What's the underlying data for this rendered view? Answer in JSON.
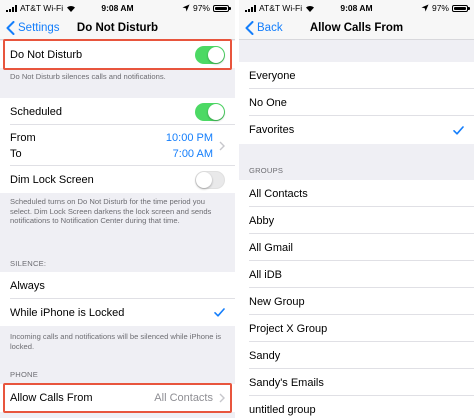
{
  "status_left": {
    "carrier": "AT&T Wi-Fi",
    "time": "9:08 AM",
    "battery": "97%"
  },
  "status_right": {
    "carrier": "AT&T Wi-Fi",
    "time": "9:08 AM",
    "battery": "97%"
  },
  "dnd": {
    "back_label": "Settings",
    "title": "Do Not Disturb",
    "dnd_label": "Do Not Disturb",
    "dnd_on": true,
    "dnd_footer": "Do Not Disturb silences calls and notifications.",
    "scheduled_label": "Scheduled",
    "scheduled_on": true,
    "from_label": "From",
    "to_label": "To",
    "from_time": "10:00 PM",
    "to_time": "7:00 AM",
    "dim_label": "Dim Lock Screen",
    "dim_on": false,
    "dim_footer": "Scheduled turns on Do Not Disturb for the time period you select. Dim Lock Screen darkens the lock screen and sends notifications to Notification Center during that time.",
    "silence_header": "SILENCE:",
    "always_label": "Always",
    "locked_label": "While iPhone is Locked",
    "silence_footer": "Incoming calls and notifications will be silenced while iPhone is locked.",
    "phone_header": "PHONE",
    "allow_calls_label": "Allow Calls From",
    "allow_calls_value": "All Contacts"
  },
  "allow": {
    "back_label": "Back",
    "title": "Allow Calls From",
    "options": [
      "Everyone",
      "No One",
      "Favorites"
    ],
    "selected": "Favorites",
    "groups_header": "GROUPS",
    "groups": [
      "All Contacts",
      "Abby",
      "All Gmail",
      "All iDB",
      "New Group",
      "Project X Group",
      "Sandy",
      "Sandy's Emails",
      "untitled group"
    ]
  },
  "colors": {
    "accent": "#147efb",
    "toggle_on": "#4cd964",
    "highlight": "#e8553d"
  }
}
